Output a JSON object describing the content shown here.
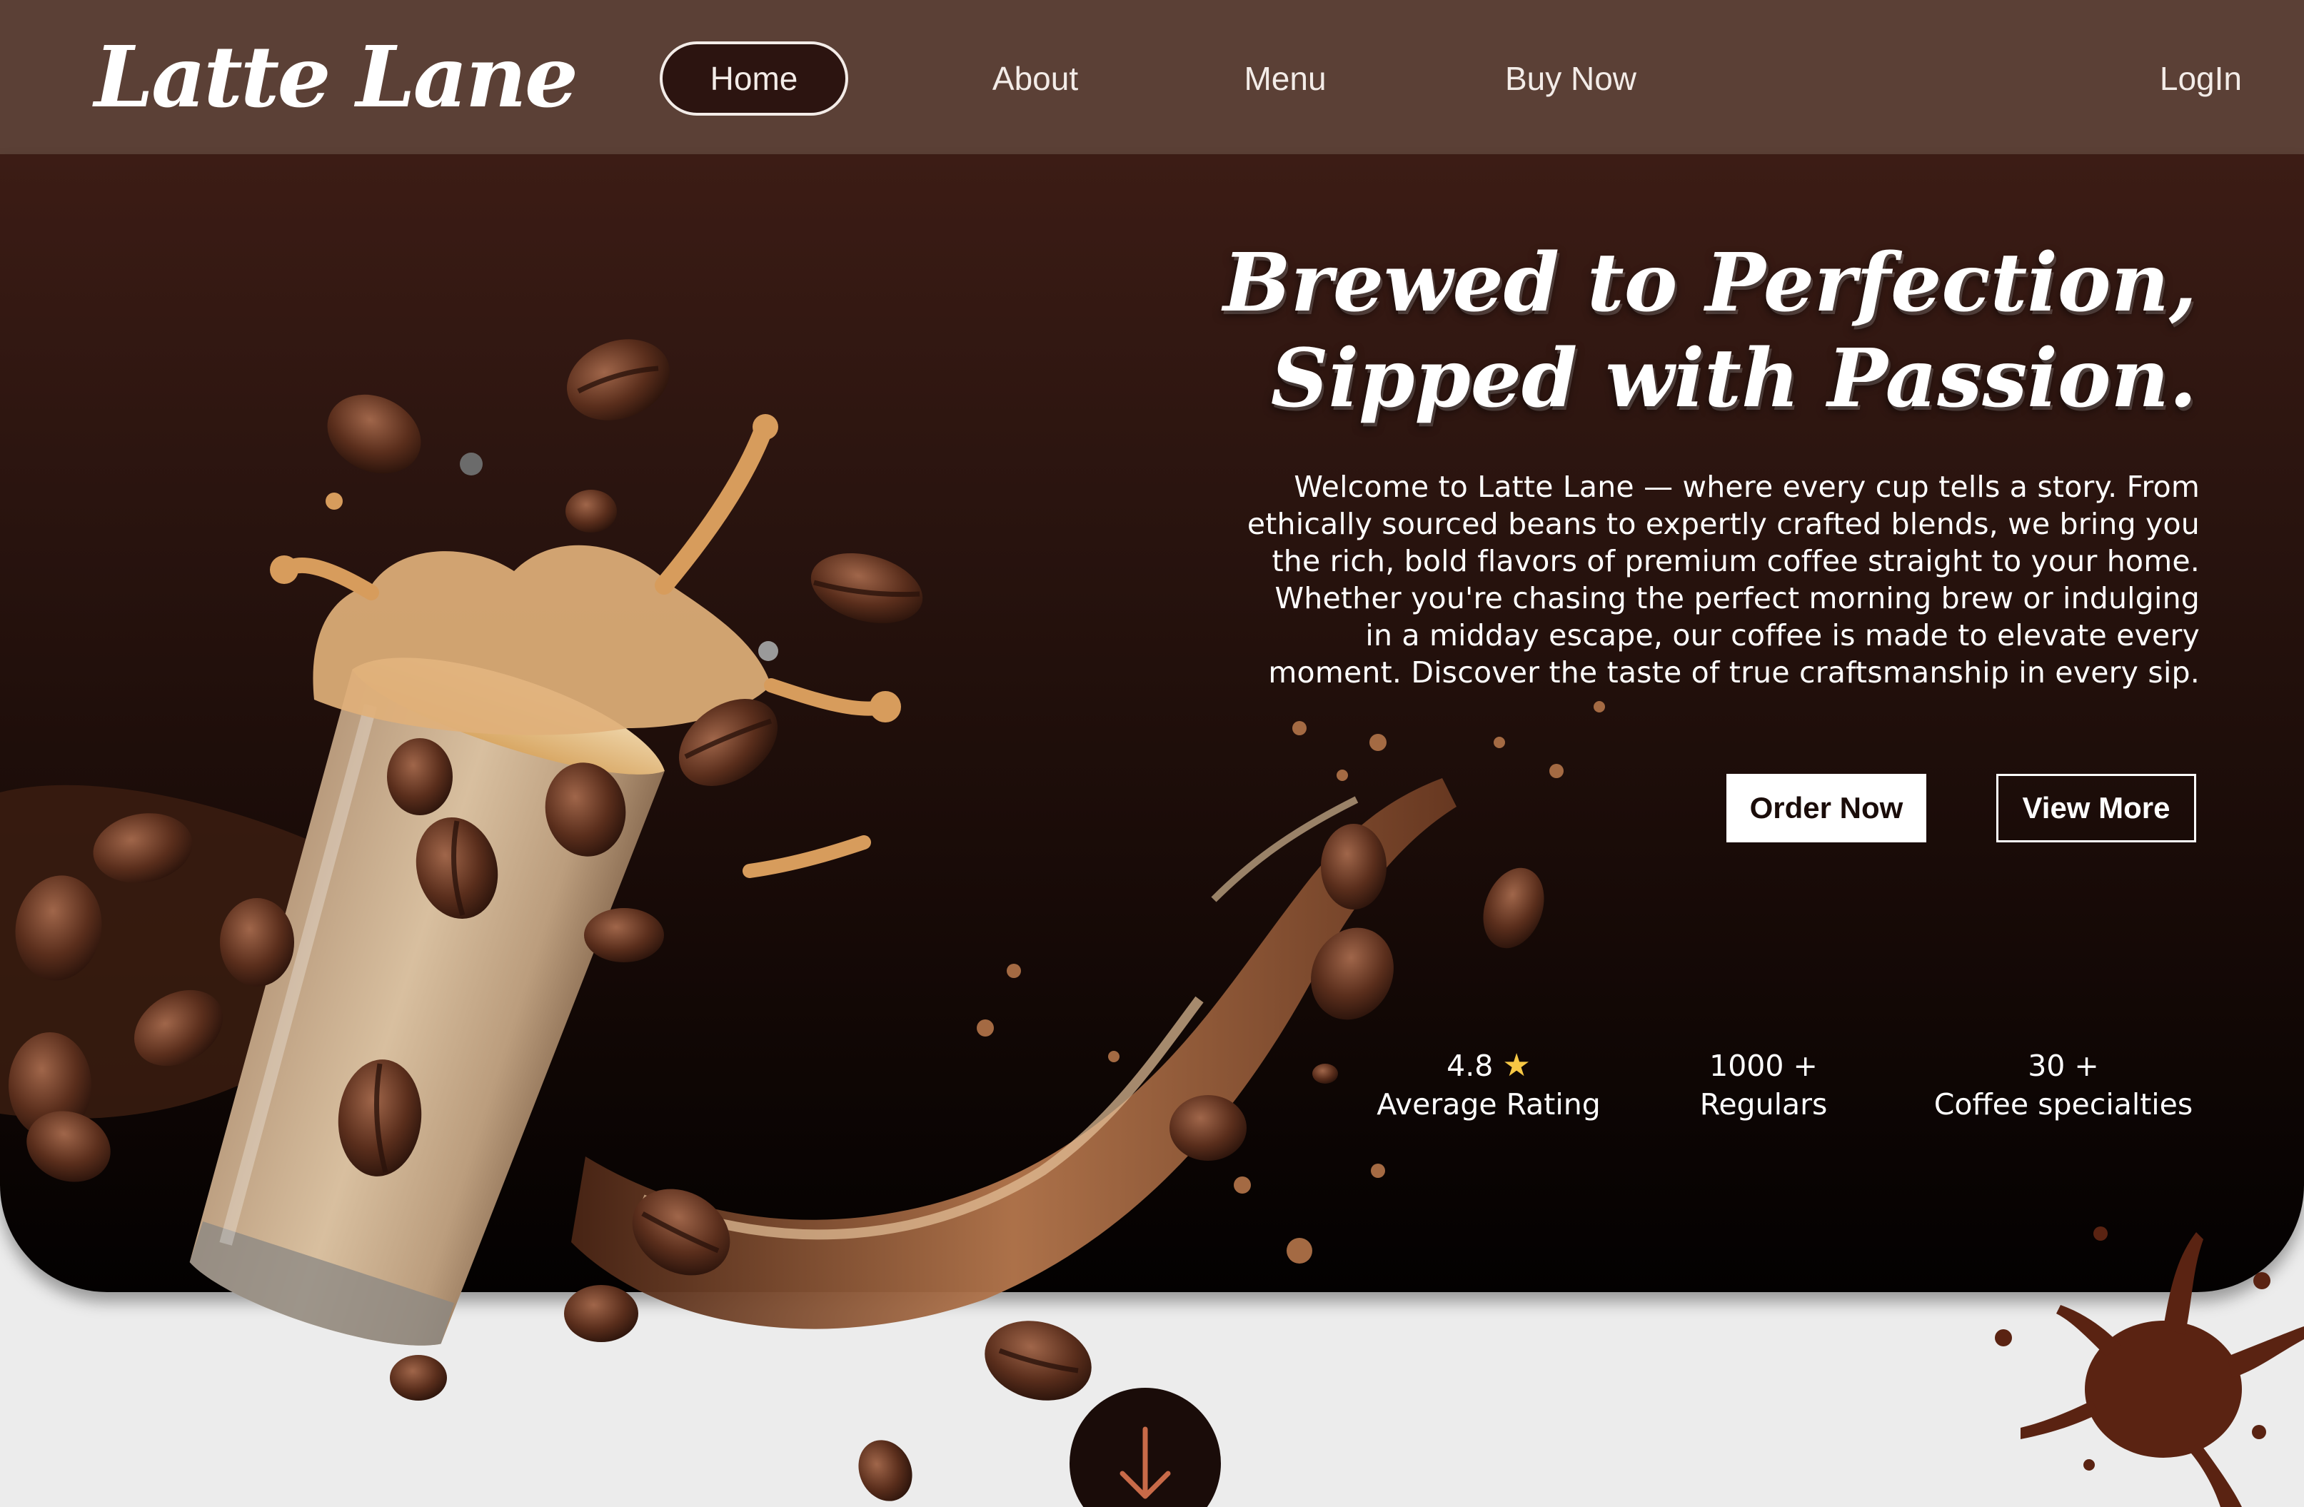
{
  "brand": {
    "logo": "Latte Lane"
  },
  "nav": {
    "home": "Home",
    "about": "About",
    "menu": "Menu",
    "buy_now": "Buy Now",
    "login": "LogIn"
  },
  "hero": {
    "headline_line1": "Brewed to Perfection,",
    "headline_line2": "Sipped with Passion.",
    "intro_lines": [
      "Welcome to Latte Lane — where every cup tells a story. From",
      "ethically sourced beans to expertly crafted blends, we bring you",
      "the rich, bold flavors of premium coffee straight to your home.",
      "Whether you're chasing the perfect morning brew or indulging",
      "in a midday escape, our coffee is made to elevate every",
      "moment. Discover the taste of true craftsmanship in every sip."
    ],
    "order_button": "Order Now",
    "view_button": "View More"
  },
  "stats": [
    {
      "value": "4.8",
      "icon": "star-icon",
      "label": "Average Rating"
    },
    {
      "value": "1000 +",
      "label": "Regulars"
    },
    {
      "value": "30 +",
      "label": "Coffee specialties"
    }
  ],
  "scroll": {
    "icon": "arrow-down-icon"
  },
  "colors": {
    "nav_bg": "#5b4036",
    "hero_dark": "#150906",
    "accent_arrow": "#c86a48",
    "page_bg": "#ececec",
    "star": "#f6c744"
  }
}
